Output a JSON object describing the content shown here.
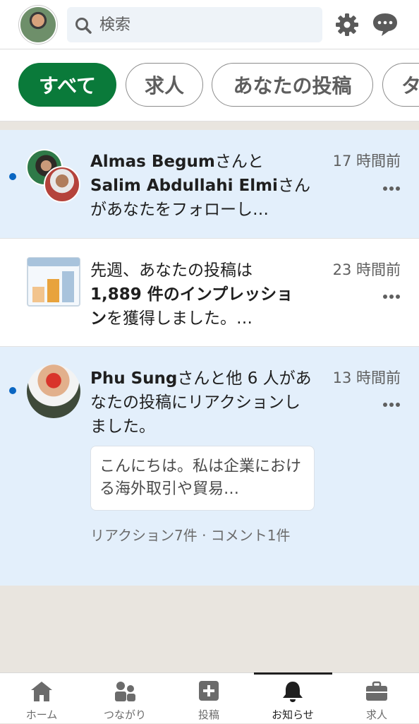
{
  "header": {
    "search_placeholder": "検索",
    "profile_icon": "user-avatar",
    "settings_icon": "gear-icon",
    "messages_icon": "chat-bubble-icon"
  },
  "filters": [
    {
      "label": "すべて",
      "active": true
    },
    {
      "label": "求人",
      "active": false
    },
    {
      "label": "あなたの投稿",
      "active": false
    },
    {
      "label": "タ",
      "active": false
    }
  ],
  "notifications": [
    {
      "name1": "Almas Begum",
      "connector": "さんと",
      "name2": "Salim Abdullahi Elmi",
      "rest": "さんがあなたをフォローし…",
      "time": "17 時間前",
      "unread": true
    },
    {
      "prefix": "先週、あなたの投稿は",
      "bold": "1,889 件のインプレッション",
      "suffix": "を獲得しました。…",
      "time": "23 時間前",
      "unread": false
    },
    {
      "name": "Phu Sung",
      "rest": "さんと他 6 人があなたの投稿にリアクションしました。",
      "time": "13 時間前",
      "preview": "こんにちは。私は企業における海外取引や貿易…",
      "stats": "リアクション7件 · コメント1件",
      "unread": true
    }
  ],
  "nav": [
    {
      "label": "ホーム",
      "icon": "home-icon"
    },
    {
      "label": "つながり",
      "icon": "people-icon"
    },
    {
      "label": "投稿",
      "icon": "plus-box-icon"
    },
    {
      "label": "お知らせ",
      "icon": "bell-icon",
      "active": true
    },
    {
      "label": "求人",
      "icon": "briefcase-icon"
    }
  ],
  "colors": {
    "accent": "#0a7a3a",
    "unread_bg": "#e3effb",
    "unread_dot": "#0a66c2"
  }
}
